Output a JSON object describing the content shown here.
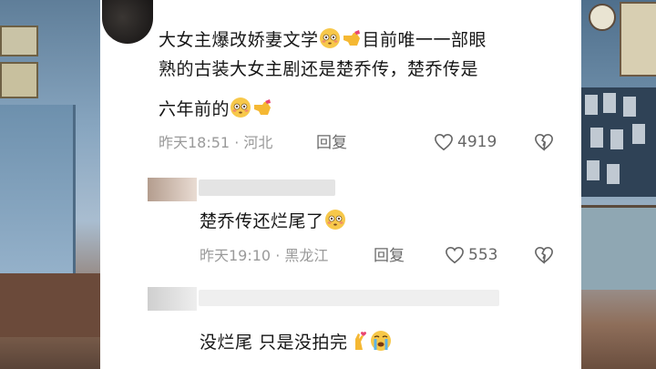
{
  "comments": [
    {
      "text_line1": "大女主爆改娇妻文学",
      "text_line1b": "目前唯一一部眼",
      "text_line2": "熟的古装大女主剧还是楚乔传，楚乔传是",
      "text_line3": "六年前的",
      "time_location": "昨天18:51 · 河北",
      "reply_label": "回复",
      "likes": "4919"
    },
    {
      "text": "楚乔传还烂尾了",
      "time_location": "昨天19:10 · 黑龙江",
      "reply_label": "回复",
      "likes": "553"
    },
    {
      "text": "没烂尾 只是没拍完"
    }
  ],
  "icons": {
    "like": "heart-outline-icon",
    "dislike": "broken-heart-icon",
    "flushed_emoji": "flushed-face-emoji",
    "pointing_emoji": "pointing-hand-emoji",
    "crossed_fingers": "crossed-fingers-heart-emoji",
    "crying_emoji": "crying-face-emoji"
  },
  "colors": {
    "text": "#161616",
    "meta": "#9a9a9a",
    "background": "#ffffff"
  }
}
